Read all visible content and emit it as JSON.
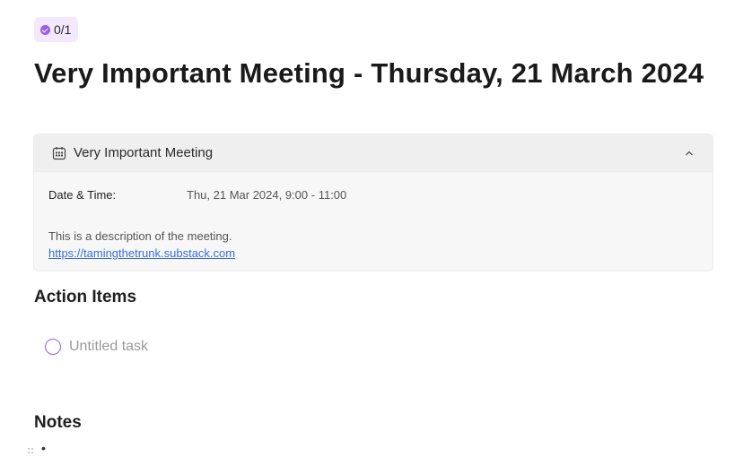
{
  "progress_badge": {
    "text": "0/1"
  },
  "page": {
    "title": "Very Important Meeting - Thursday, 21 March 2024"
  },
  "meeting_card": {
    "title": "Very Important Meeting",
    "date_time_label": "Date & Time:",
    "date_time_value": "Thu, 21 Mar 2024, 9:00 - 11:00",
    "description": "This is a description of the meeting.",
    "link": "https://tamingthetrunk.substack.com",
    "icons": {
      "header": "calendar-icon",
      "toggle": "chevron-up-icon"
    }
  },
  "action_items": {
    "heading": "Action Items",
    "tasks": [
      {
        "text": "Untitled task",
        "done": false
      }
    ]
  },
  "notes": {
    "heading": "Notes",
    "bullet": "•"
  },
  "colors": {
    "accent": "#9b5de5",
    "badge_bg": "#f3e8fd",
    "link": "#3a6fd8"
  }
}
